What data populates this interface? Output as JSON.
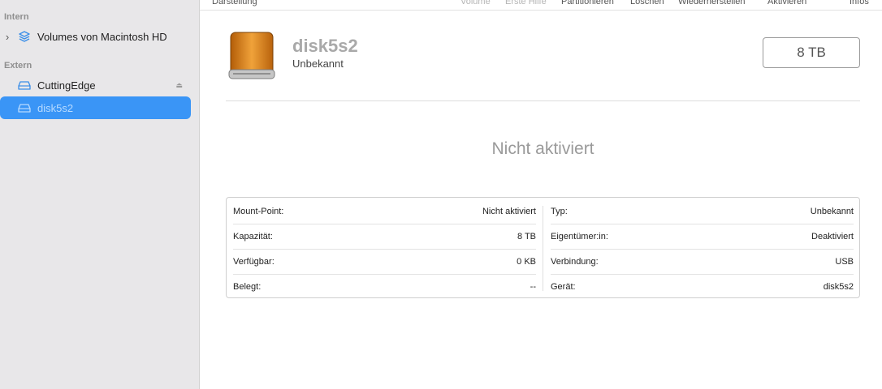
{
  "sidebar": {
    "sections": [
      {
        "label": "Intern"
      },
      {
        "label": "Extern"
      }
    ],
    "items": [
      {
        "label": "Volumes von Macintosh HD",
        "icon": "layers-icon"
      },
      {
        "label": "CuttingEdge",
        "icon": "external-drive-icon",
        "eject": "⏏"
      },
      {
        "label": "disk5s2",
        "icon": "external-drive-icon"
      }
    ]
  },
  "toolbar": {
    "items": [
      "Darstellung",
      "Volume",
      "Erste Hilfe",
      "Partitionieren",
      "Löschen",
      "Wiederherstellen",
      "Aktivieren",
      "Infos"
    ]
  },
  "disk": {
    "name": "disk5s2",
    "subtitle": "Unbekannt",
    "size": "8 TB",
    "status": "Nicht aktiviert"
  },
  "info": {
    "left": [
      {
        "label": "Mount-Point:",
        "value": "Nicht aktiviert"
      },
      {
        "label": "Kapazität:",
        "value": "8 TB"
      },
      {
        "label": "Verfügbar:",
        "value": "0 KB"
      },
      {
        "label": "Belegt:",
        "value": "--"
      }
    ],
    "right": [
      {
        "label": "Typ:",
        "value": "Unbekannt"
      },
      {
        "label": "Eigentümer:in:",
        "value": "Deaktiviert"
      },
      {
        "label": "Verbindung:",
        "value": "USB"
      },
      {
        "label": "Gerät:",
        "value": "disk5s2"
      }
    ]
  },
  "colors": {
    "accent": "#3a95f6",
    "drive_orange": "#e08a1e"
  }
}
